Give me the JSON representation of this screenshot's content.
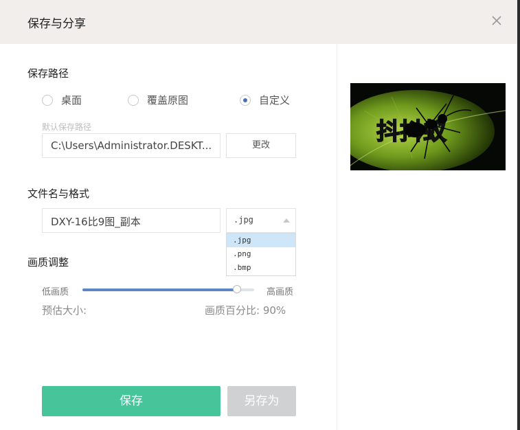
{
  "dialog": {
    "title": "保存与分享",
    "close_icon": "close-icon"
  },
  "save_path": {
    "heading": "保存路径",
    "options": [
      {
        "label": "桌面",
        "checked": false
      },
      {
        "label": "覆盖原图",
        "checked": false
      },
      {
        "label": "自定义",
        "checked": true
      }
    ],
    "hint": "默认保存路径",
    "path_value": "C:\\Users\\Administrator.DESKT...",
    "change_label": "更改"
  },
  "file": {
    "heading": "文件名与格式",
    "name_value": "DXY-16比9图_副本",
    "format_selected": ".jpg",
    "format_options": [
      ".jpg",
      ".png",
      ".bmp"
    ],
    "highlighted_option": ".jpg"
  },
  "quality": {
    "heading": "画质调整",
    "low_label": "低画质",
    "high_label": "高画质",
    "level_percent": 90,
    "estimate_label": "预估大小:",
    "percent_label": "画质百分比:  90%"
  },
  "actions": {
    "save_label": "保存",
    "save_as_label": "另存为"
  },
  "colors": {
    "accent": "#46c59b",
    "slider": "#5c86c6",
    "disabled": "#cfd1d3",
    "titlebar": "#f1eeec"
  },
  "preview": {
    "overlay_text": "抖抖蚁"
  }
}
